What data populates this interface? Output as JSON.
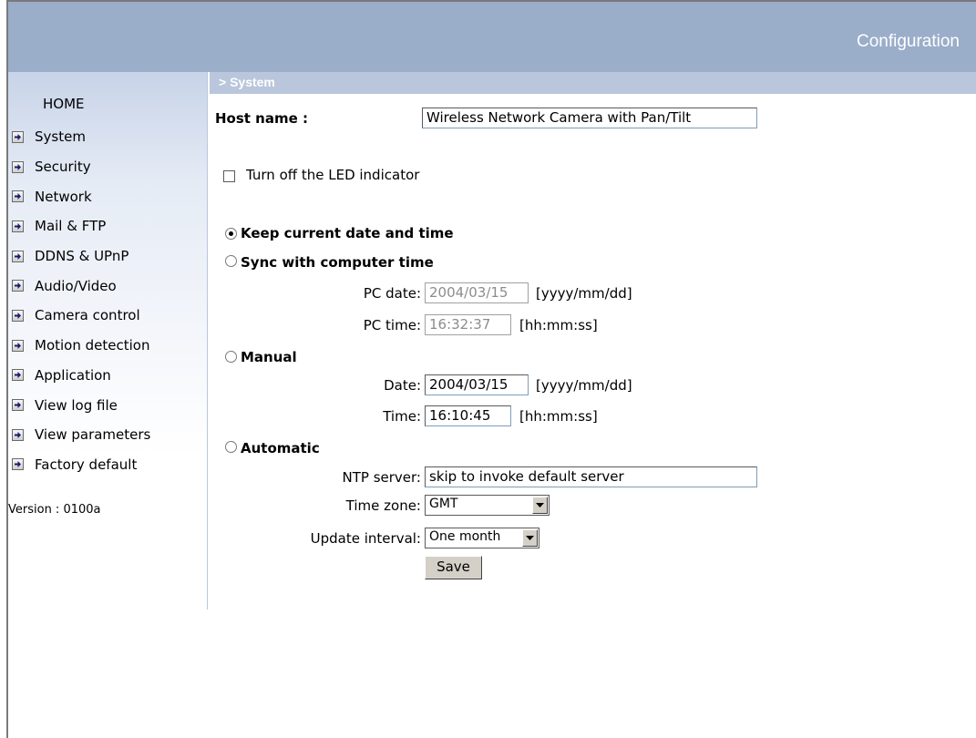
{
  "header": {
    "title": "Configuration"
  },
  "section": {
    "title": "> System"
  },
  "sidebar": {
    "home": "HOME",
    "items": [
      {
        "label": "System"
      },
      {
        "label": "Security"
      },
      {
        "label": "Network"
      },
      {
        "label": "Mail & FTP"
      },
      {
        "label": "DDNS & UPnP"
      },
      {
        "label": "Audio/Video"
      },
      {
        "label": "Camera control"
      },
      {
        "label": "Motion detection"
      },
      {
        "label": "Application"
      },
      {
        "label": "View log file"
      },
      {
        "label": "View parameters"
      },
      {
        "label": "Factory default"
      }
    ],
    "version": "Version : 0100a"
  },
  "form": {
    "host_name_label": "Host name :",
    "host_name_value": "Wireless Network Camera with Pan/Tilt",
    "led_label": "Turn off the LED indicator",
    "led_checked": false,
    "keep_time_label": "Keep current date and time",
    "sync_label": "Sync with computer time",
    "pc_date_label": "PC date:",
    "pc_date_value": "2004/03/15",
    "pc_date_format": "[yyyy/mm/dd]",
    "pc_time_label": "PC time:",
    "pc_time_value": "16:32:37",
    "pc_time_format": "[hh:mm:ss]",
    "manual_label": "Manual",
    "date_label": "Date:",
    "date_value": "2004/03/15",
    "date_format": "[yyyy/mm/dd]",
    "time_label": "Time:",
    "time_value": "16:10:45",
    "time_format": "[hh:mm:ss]",
    "automatic_label": "Automatic",
    "ntp_label": "NTP server:",
    "ntp_value": "skip to invoke default server",
    "timezone_label": "Time zone:",
    "timezone_value": "GMT",
    "interval_label": "Update interval:",
    "interval_value": "One month",
    "save_label": "Save",
    "selected_time_mode": "keep"
  },
  "colors": {
    "header_bg": "#9aadc9",
    "section_bg": "#b9c6dc"
  }
}
